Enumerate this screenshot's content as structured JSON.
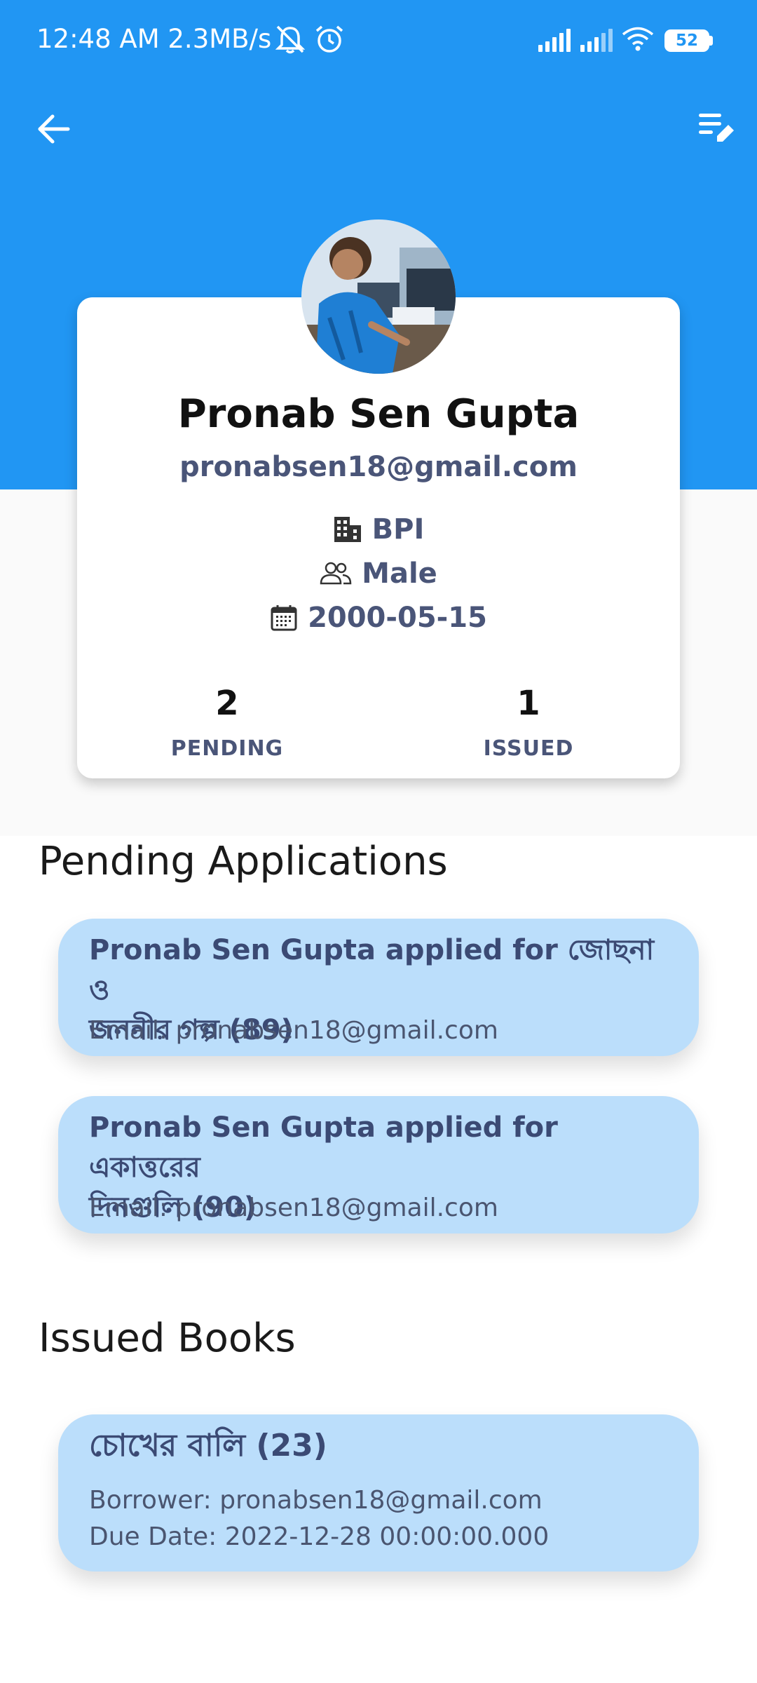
{
  "status_bar": {
    "time": "12:48 AM",
    "speed": "2.3MB/s",
    "battery": "52",
    "icons": [
      "silent-bell-icon",
      "alarm-icon",
      "signal-icon",
      "signal-icon",
      "wifi-icon",
      "battery-icon"
    ]
  },
  "app_bar": {
    "back_icon": "arrow-left-icon",
    "edit_icon": "edit-list-icon"
  },
  "colors": {
    "primary": "#2196F3",
    "card_blue": "#BBDEFB",
    "text_muted": "#4a5578"
  },
  "profile": {
    "name": "Pronab Sen Gupta",
    "email": "pronabsen18@gmail.com",
    "department": "BPI",
    "gender": "Male",
    "dob": "2000-05-15",
    "stats": {
      "pending_count": "2",
      "pending_label": "PENDING",
      "issued_count": "1",
      "issued_label": "ISSUED"
    }
  },
  "pending": {
    "title": "Pending Applications",
    "items": [
      {
        "line1": "Pronab Sen Gupta applied for জোছনা ও",
        "line2": "জননীর গল্প (89)",
        "email": "Email: pronabsen18@gmail.com"
      },
      {
        "line1": "Pronab Sen Gupta applied for একাত্তরের",
        "line2": "দিনগুলি (90)",
        "email": "Email: pronabsen18@gmail.com"
      }
    ]
  },
  "issued": {
    "title": "Issued Books",
    "items": [
      {
        "book": "চোখের বালি (23)",
        "borrower": "Borrower: pronabsen18@gmail.com",
        "due": "Due Date: 2022-12-28 00:00:00.000"
      }
    ]
  }
}
